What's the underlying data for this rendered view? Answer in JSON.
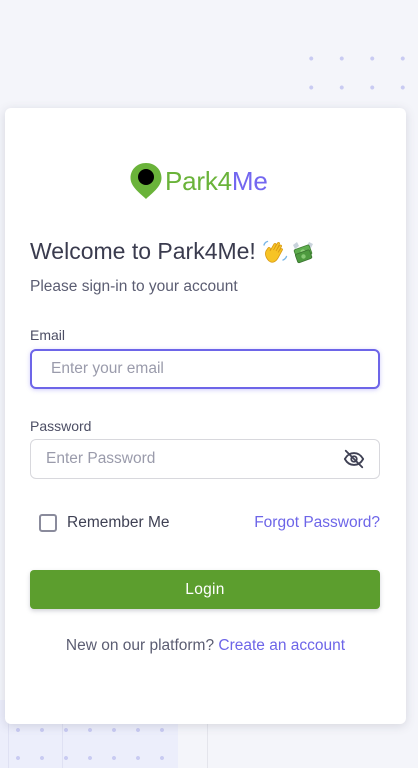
{
  "brand": {
    "name_part1": "Park4",
    "name_part2": "Me",
    "color_green": "#6ab33a",
    "color_purple": "#7367f0",
    "icon": "map-pin-icon"
  },
  "welcome": {
    "title": "Welcome to Park4Me!",
    "emojis": [
      "waving-hand-emoji",
      "money-with-wings-emoji"
    ]
  },
  "subtitle": "Please sign-in to your account",
  "form": {
    "email": {
      "label": "Email",
      "placeholder": "Enter your email",
      "value": ""
    },
    "password": {
      "label": "Password",
      "placeholder": "Enter Password",
      "value": "",
      "toggle_icon": "eye-off-icon"
    },
    "remember_label": "Remember Me",
    "remember_checked": false,
    "forgot_label": "Forgot Password?",
    "login_label": "Login"
  },
  "footer": {
    "prompt": "New on our platform?",
    "link": "Create an account"
  },
  "colors": {
    "primary_button": "#5c9e2e",
    "link": "#6d65e8",
    "focus_border": "#6d65e8"
  }
}
